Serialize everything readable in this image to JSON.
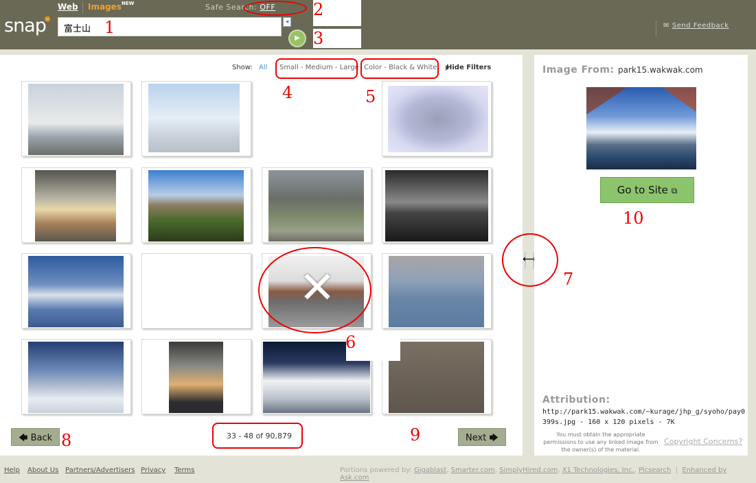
{
  "header": {
    "logo": "snap",
    "tab_web": "Web",
    "tab_images": "Images",
    "new_badge": "NEW",
    "safe_search_label": "Safe Search:",
    "safe_search_value": "OFF",
    "search_query": "富士山",
    "feedback": "Send Feedback"
  },
  "filters": {
    "show_label": "Show:",
    "all": "All",
    "size": "Small - Medium - Large",
    "color": "Color - Black & White",
    "hide": "Hide Filters"
  },
  "pagination": {
    "back": "Back",
    "next": "Next",
    "range": "33 - 48 of 90,879"
  },
  "detail": {
    "image_from_label": "Image From:",
    "image_from_host": "park15.wakwak.com",
    "goto_label": "Go to Site",
    "attribution_label": "Attribution:",
    "attribution_url": "http://park15.wakwak.com/~kurage/jhp_g/syoho/pay0399s.jpg - 160 x 120 pixels - 7K",
    "note": "You must obtain the appropriate permissions to use any linked image from the owner(s) of the material.",
    "copyright": "Copyright Concerns?"
  },
  "footer": {
    "links": [
      "Help",
      "About Us",
      "Partners/Advertisers",
      "Privacy",
      "Terms"
    ],
    "powered_label": "Portions powered by:",
    "powered_links": [
      "Gigablast",
      "Smarter.com",
      "SimplyHired.com",
      "X1 Technologies, Inc.",
      "Picsearch"
    ],
    "enhanced": "Enhanced by Ask.com"
  },
  "annotations": {
    "n1": "1",
    "n2": "2",
    "n3": "3",
    "n4": "4",
    "n5": "5",
    "n6": "6",
    "n7": "7",
    "n8": "8",
    "n9": "9",
    "n10": "10"
  },
  "colors": {
    "header_bg": "#696956",
    "accent_orange": "#f0a030",
    "button_green": "#8cc46e",
    "annotation_red": "#e00000"
  }
}
